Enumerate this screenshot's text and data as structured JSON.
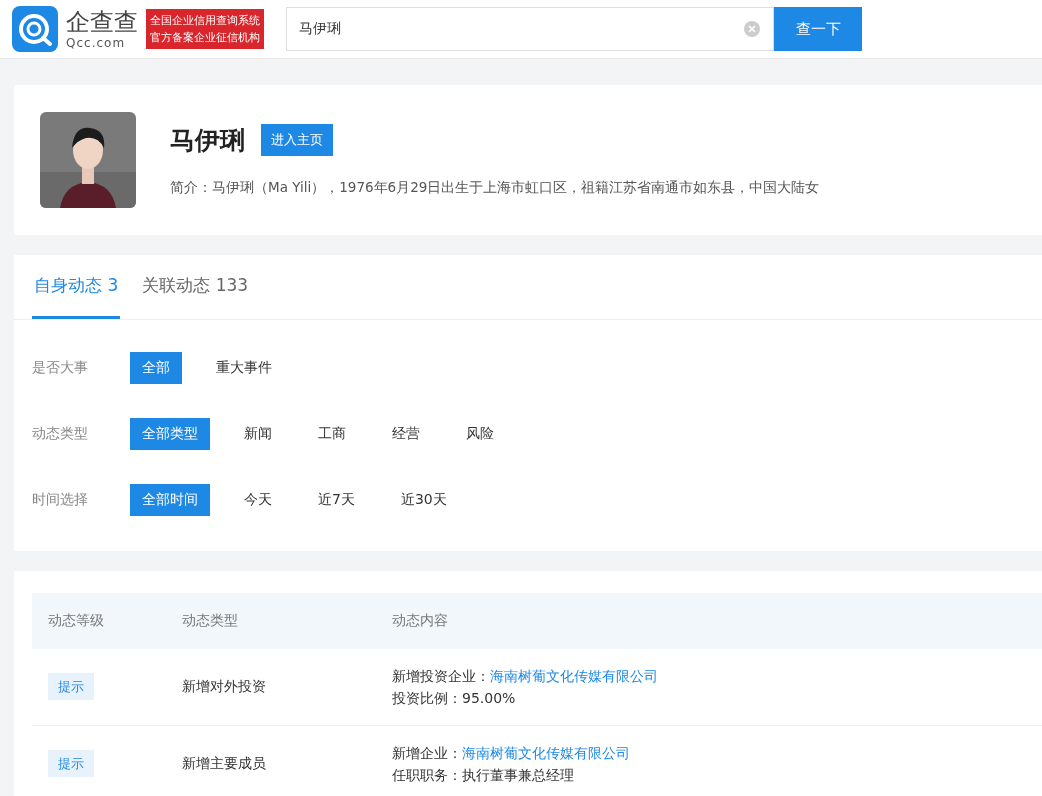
{
  "header": {
    "logo_text": "企查查",
    "logo_sub": "Qcc.com",
    "banner_lines": [
      "全国企业信用查询系统",
      "官方备案企业征信机构"
    ],
    "search": {
      "value": "马伊琍"
    },
    "search_button": "查一下"
  },
  "profile": {
    "name": "马伊琍",
    "home_button": "进入主页",
    "bio": "简介：马伊琍（Ma Yili），1976年6月29日出生于上海市虹口区，祖籍江苏省南通市如东县，中国大陆女"
  },
  "tabs": [
    {
      "label": "自身动态 3",
      "selected": true
    },
    {
      "label": "关联动态 133",
      "selected": false
    }
  ],
  "filters": [
    {
      "label": "是否大事",
      "options": [
        {
          "label": "全部",
          "selected": true
        },
        {
          "label": "重大事件",
          "selected": false
        }
      ]
    },
    {
      "label": "动态类型",
      "options": [
        {
          "label": "全部类型",
          "selected": true
        },
        {
          "label": "新闻",
          "selected": false
        },
        {
          "label": "工商",
          "selected": false
        },
        {
          "label": "经营",
          "selected": false
        },
        {
          "label": "风险",
          "selected": false
        }
      ]
    },
    {
      "label": "时间选择",
      "options": [
        {
          "label": "全部时间",
          "selected": true
        },
        {
          "label": "今天",
          "selected": false
        },
        {
          "label": "近7天",
          "selected": false
        },
        {
          "label": "近30天",
          "selected": false
        }
      ]
    }
  ],
  "table": {
    "columns": [
      "动态等级",
      "动态类型",
      "动态内容"
    ],
    "rows": [
      {
        "level": "提示",
        "type": "新增对外投资",
        "content": [
          {
            "label": "新增投资企业：",
            "value": "海南树葡文化传媒有限公司",
            "kind": "link"
          },
          {
            "label": "投资比例：",
            "value": "95.00%",
            "kind": "text"
          }
        ]
      },
      {
        "level": "提示",
        "type": "新增主要成员",
        "content": [
          {
            "label": "新增企业：",
            "value": "海南树葡文化传媒有限公司",
            "kind": "link"
          },
          {
            "label": "任职职务：",
            "value": "执行董事兼总经理",
            "kind": "text"
          }
        ]
      }
    ]
  }
}
